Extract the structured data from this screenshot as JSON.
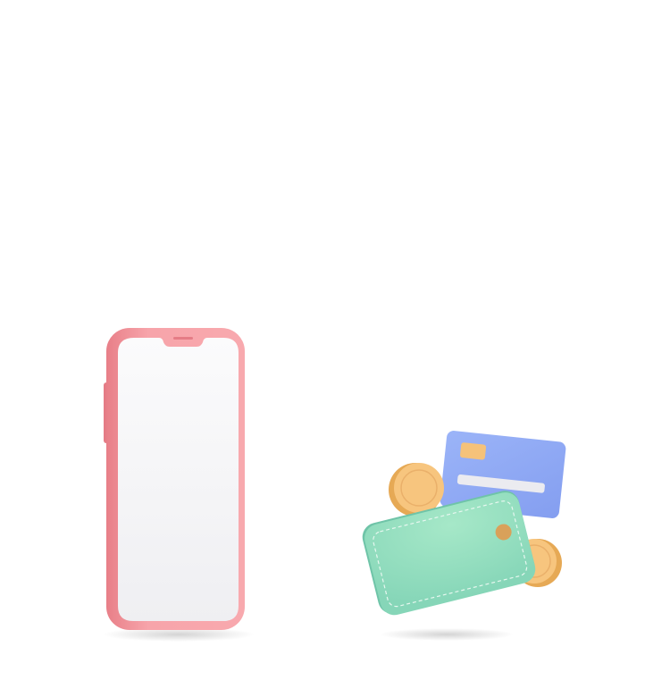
{
  "illustration": {
    "phone": {
      "icon": "smartphone-icon",
      "frame_color": "#f49aa0",
      "screen_color": "#f3f3f5"
    },
    "wallet": {
      "icon": "wallet-icon",
      "color": "#8edbbd",
      "clasp_color": "#d9a15a"
    },
    "card": {
      "icon": "credit-card-icon",
      "color": "#8fa8f5",
      "chip_color": "#f5c27a"
    },
    "coins": {
      "icon": "coin-icon",
      "color": "#f5c27a",
      "count": 2
    }
  }
}
